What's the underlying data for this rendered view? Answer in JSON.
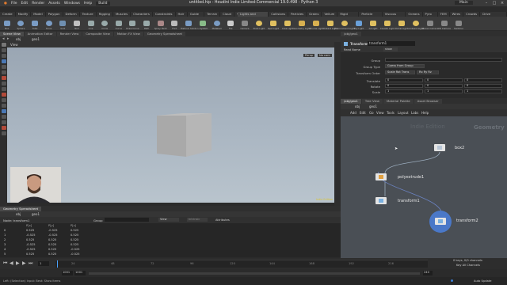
{
  "window": {
    "title": "untitled.hip - Houdini Indie Limited-Commercial 19.0.498 - Python 3",
    "menus": [
      "File",
      "Edit",
      "Render",
      "Assets",
      "Windows",
      "Help"
    ],
    "build_label": "Build",
    "main_label": "Main"
  },
  "shelf": {
    "tabs": [
      "Create",
      "Modify",
      "Model",
      "Polygon",
      "Deform",
      "Texture",
      "Rigging",
      "Muscles",
      "Characters",
      "Constraints",
      "Hair Utils",
      "Guide Process",
      "Terrain FX",
      "Cloud FX",
      "Volume"
    ],
    "tools": [
      "Box",
      "Sphere",
      "Tube",
      "Torus",
      "Grid",
      "Null",
      "Line",
      "Circle",
      "Curve",
      "Draw Curve",
      "Path",
      "Spray Paint",
      "Font",
      "Platonic Solids",
      "L-System",
      "Metaball",
      "File"
    ],
    "light_tabs": [
      "Lights and Cameras",
      "Collisions",
      "Particles",
      "Grains",
      "Vellum",
      "Rigid Bodies",
      "Particle Fluids",
      "Viscous Fluids",
      "Oceans",
      "Pyro FX",
      "FEM",
      "Wires",
      "Crowds",
      "Drive Simulation"
    ],
    "light_tools": [
      "Camera",
      "Point Light",
      "Spot Light",
      "Area Light",
      "Geometry Light",
      "Volume Light",
      "Distant Light",
      "Environment Light",
      "Sky Light",
      "GI Light",
      "Caustic Light",
      "Portal Light",
      "Ambient Light",
      "Stereo Camera",
      "VR Camera",
      "Switcher"
    ]
  },
  "left_pane": {
    "tabs": [
      "Scene View",
      "Animation Editor",
      "Render View",
      "Composite View",
      "Motion FX View",
      "Geometry Spreadsheet"
    ],
    "path": [
      "obj",
      "geo1"
    ],
    "view_label": "View",
    "persp_label": "Persp",
    "cam_label": "No cam",
    "indie_label": "Indie Edition"
  },
  "spreadsheet": {
    "tab": "Geometry Spreadsheet",
    "node_label": "Node: transform1",
    "group_label": "Group",
    "view_label": "View",
    "intrinsic_label": "Intrinsic",
    "attrib_label": "Attributes",
    "columns": [
      "",
      "P[x]",
      "P[y]",
      "P[z]"
    ],
    "rows": [
      [
        "0",
        "0.525",
        "-0.525",
        "0.525"
      ],
      [
        "1",
        "-0.525",
        "-0.525",
        "0.525"
      ],
      [
        "2",
        "0.525",
        "0.525",
        "0.525"
      ],
      [
        "3",
        "-0.525",
        "0.525",
        "0.525"
      ],
      [
        "4",
        "-0.525",
        "0.525",
        "-0.525"
      ],
      [
        "5",
        "0.525",
        "0.525",
        "-0.525"
      ]
    ]
  },
  "timeline": {
    "frame": "1",
    "start": "1001",
    "end": "1001",
    "end2": "240",
    "ticks": [
      "24",
      "48",
      "72",
      "96",
      "120",
      "144",
      "168",
      "192",
      "216"
    ],
    "keys_label": "0 keys, 0/0 channels",
    "key_all_label": "Key All Channels",
    "status": "Left: (Selection) Input: Best: Show items",
    "auto_update": "Auto Update"
  },
  "params": {
    "tab_label": "Transform",
    "node_name": "transform1",
    "read_name": "Read Name",
    "show_label": "show",
    "rows": [
      {
        "label": "Group",
        "value": ""
      },
      {
        "label": "Group Type",
        "value": "Guess from Group"
      },
      {
        "label": "Transform Order",
        "value": "Scale Rot Trans"
      },
      {
        "label": "Translate",
        "value": "0"
      },
      {
        "label": "Rotate",
        "value": "0"
      },
      {
        "label": "Scale",
        "value": "1"
      }
    ],
    "rot_order": "Rx Ry Rz"
  },
  "network": {
    "tabs": [
      "/obj/geo1",
      "Tree View",
      "Material Palette",
      "Asset Browser"
    ],
    "path": [
      "obj",
      "geo1"
    ],
    "menus": [
      "Add",
      "Edit",
      "Go",
      "View",
      "Tools",
      "Layout",
      "Labs",
      "Help"
    ],
    "watermark_indie": "Indie Edition",
    "watermark_geo": "Geometry",
    "nodes": [
      "box2",
      "polyextrude1",
      "transform1",
      "transform2"
    ]
  }
}
